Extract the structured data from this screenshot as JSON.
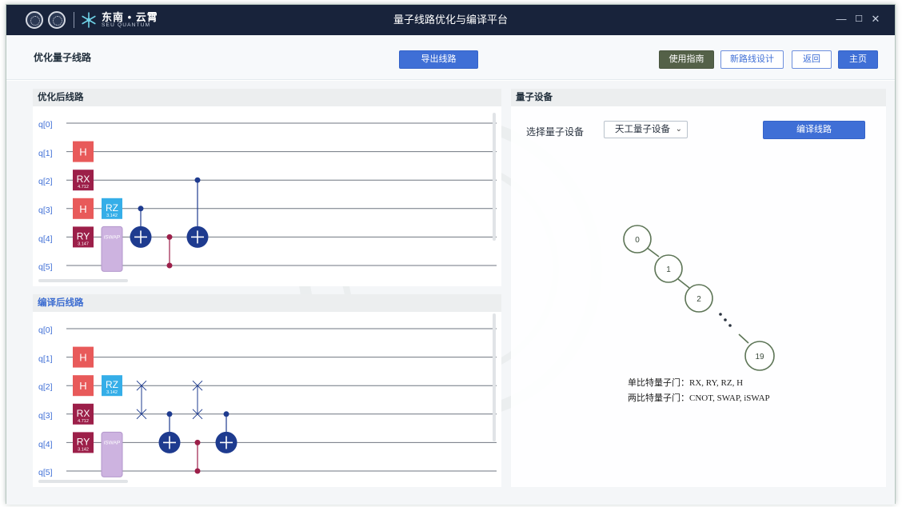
{
  "window": {
    "app_title": "量子线路优化与编译平台",
    "brand_name": "东南 • 云霄",
    "brand_sub": "SEU QUANTUM",
    "controls": [
      "—",
      "☐",
      "✕"
    ]
  },
  "toolbar": {
    "page_title": "优化量子线路",
    "export_label": "导出线路",
    "guide_label": "使用指南",
    "new_design_label": "新路线设计",
    "back_label": "返回",
    "home_label": "主页"
  },
  "optimized": {
    "title": "优化后线路",
    "qubits": [
      "q[0]",
      "q[1]",
      "q[2]",
      "q[3]",
      "q[4]",
      "q[5]"
    ],
    "gates": [
      {
        "name": "H",
        "qubit": 1,
        "col": 0,
        "color": "#e85a5a"
      },
      {
        "name": "RX",
        "param": "4.712",
        "qubit": 2,
        "col": 0,
        "color": "#9c1f49"
      },
      {
        "name": "H",
        "qubit": 3,
        "col": 0,
        "color": "#e85a5a"
      },
      {
        "name": "RY",
        "param": "3.147",
        "qubit": 4,
        "col": 0,
        "color": "#9c1f49"
      },
      {
        "name": "RZ",
        "param": "3.142",
        "qubit": 3,
        "col": 1,
        "color": "#35aee8"
      },
      {
        "name": "iSWAP",
        "qubits": [
          4,
          5
        ],
        "col": 1,
        "color": "#cdb3e0"
      },
      {
        "name": "CNOT",
        "control": 3,
        "target": 4,
        "col": 2
      },
      {
        "name": "CZ",
        "qubits": [
          4,
          5
        ],
        "col": 3
      },
      {
        "name": "CNOT",
        "control": 2,
        "target": 4,
        "col": 4
      }
    ]
  },
  "compiled": {
    "title": "编译后线路",
    "qubits": [
      "q[0]",
      "q[1]",
      "q[2]",
      "q[3]",
      "q[4]",
      "q[5]"
    ],
    "gates": [
      {
        "name": "H",
        "qubit": 1,
        "col": 0,
        "color": "#e85a5a"
      },
      {
        "name": "H",
        "qubit": 2,
        "col": 0,
        "color": "#e85a5a"
      },
      {
        "name": "RX",
        "param": "4.712",
        "qubit": 3,
        "col": 0,
        "color": "#9c1f49"
      },
      {
        "name": "RY",
        "param": "3.142",
        "qubit": 4,
        "col": 0,
        "color": "#9c1f49"
      },
      {
        "name": "RZ",
        "param": "3.142",
        "qubit": 2,
        "col": 1,
        "color": "#35aee8"
      },
      {
        "name": "iSWAP",
        "qubits": [
          4,
          5
        ],
        "col": 1,
        "color": "#cdb3e0"
      },
      {
        "name": "SWAP",
        "qubits": [
          2,
          3
        ],
        "col": 2
      },
      {
        "name": "CNOT",
        "control": 3,
        "target": 4,
        "col": 3
      },
      {
        "name": "SWAP",
        "qubits": [
          2,
          3
        ],
        "col": 4
      },
      {
        "name": "CZ",
        "qubits": [
          4,
          5
        ],
        "col": 4
      },
      {
        "name": "CNOT",
        "control": 3,
        "target": 4,
        "col": 5
      }
    ]
  },
  "device": {
    "title": "量子设备",
    "select_label": "选择量子设备",
    "selected_device": "天工量子设备",
    "compile_label": "编译线路",
    "topology_nodes": [
      "0",
      "1",
      "2",
      "19"
    ],
    "single_gates_text": "单比特量子门：RX, RY, RZ, H",
    "two_gates_text": "两比特量子门：CNOT, SWAP, iSWAP"
  }
}
